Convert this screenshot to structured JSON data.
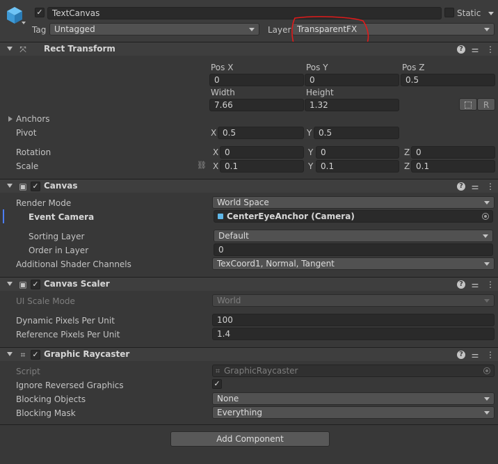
{
  "gameobject": {
    "name": "TextCanvas",
    "active": true,
    "static_label": "Static",
    "tag_label": "Tag",
    "tag_value": "Untagged",
    "layer_label": "Layer",
    "layer_value": "TransparentFX"
  },
  "rect_transform": {
    "title": "Rect Transform",
    "pos_x_label": "Pos X",
    "pos_y_label": "Pos Y",
    "pos_z_label": "Pos Z",
    "pos_x": "0",
    "pos_y": "0",
    "pos_z": "0.5",
    "width_label": "Width",
    "height_label": "Height",
    "width": "7.66",
    "height": "1.32",
    "r_button": "R",
    "anchors_label": "Anchors",
    "pivot_label": "Pivot",
    "pivot_x_label": "X",
    "pivot_x": "0.5",
    "pivot_y_label": "Y",
    "pivot_y": "0.5",
    "rotation_label": "Rotation",
    "rot_x_label": "X",
    "rot_x": "0",
    "rot_y_label": "Y",
    "rot_y": "0",
    "rot_z_label": "Z",
    "rot_z": "0",
    "scale_label": "Scale",
    "scale_x_label": "X",
    "scale_x": "0.1",
    "scale_y_label": "Y",
    "scale_y": "0.1",
    "scale_z_label": "Z",
    "scale_z": "0.1"
  },
  "canvas": {
    "title": "Canvas",
    "enabled": true,
    "render_mode_label": "Render Mode",
    "render_mode": "World Space",
    "event_camera_label": "Event Camera",
    "event_camera": "CenterEyeAnchor (Camera)",
    "sorting_layer_label": "Sorting Layer",
    "sorting_layer": "Default",
    "order_label": "Order in Layer",
    "order": "0",
    "shader_channels_label": "Additional Shader Channels",
    "shader_channels": "TexCoord1, Normal, Tangent"
  },
  "canvas_scaler": {
    "title": "Canvas Scaler",
    "enabled": true,
    "ui_scale_mode_label": "UI Scale Mode",
    "ui_scale_mode": "World",
    "dynamic_ppu_label": "Dynamic Pixels Per Unit",
    "dynamic_ppu": "100",
    "reference_ppu_label": "Reference Pixels Per Unit",
    "reference_ppu": "1.4"
  },
  "graphic_raycaster": {
    "title": "Graphic Raycaster",
    "enabled": true,
    "script_label": "Script",
    "script": "GraphicRaycaster",
    "ignore_reversed_label": "Ignore Reversed Graphics",
    "ignore_reversed": true,
    "blocking_objects_label": "Blocking Objects",
    "blocking_objects": "None",
    "blocking_mask_label": "Blocking Mask",
    "blocking_mask": "Everything"
  },
  "add_component_label": "Add Component",
  "colors": {
    "annotation_red": "#e01b1b",
    "panel_bg": "#383838",
    "field_bg": "#2a2a2a"
  },
  "icons": [
    "cube-icon",
    "move-arrows-icon",
    "help-icon",
    "sliders-icon",
    "more-icon",
    "canvas-icon",
    "camera-icon",
    "target-icon",
    "script-icon",
    "link-icon",
    "blueprint-icon"
  ]
}
